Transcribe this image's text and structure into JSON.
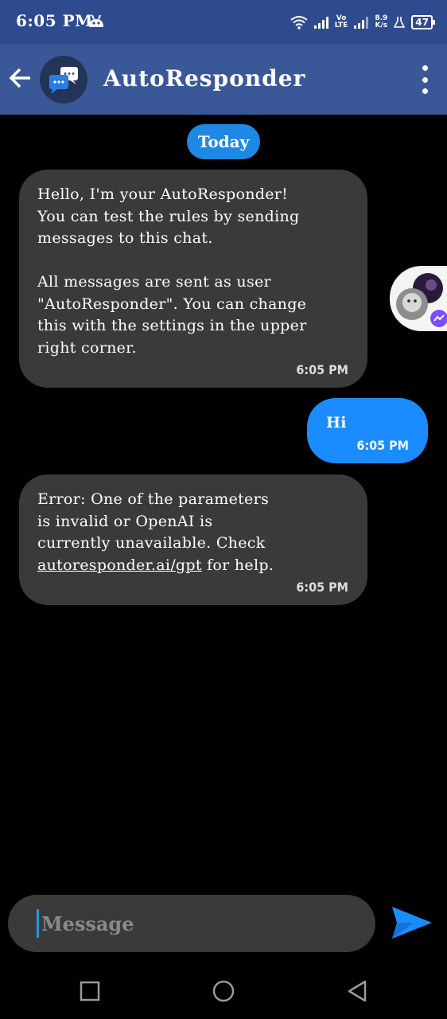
{
  "status": {
    "time": "6:05 PM",
    "vo_lte": [
      "Vo",
      "LTE"
    ],
    "speed": [
      "8.9",
      "K/s"
    ],
    "battery": "47"
  },
  "header": {
    "title": "AutoResponder",
    "back_icon": "arrow-left-icon",
    "menu_icon": "more-vert-icon"
  },
  "chat": {
    "date_label": "Today",
    "messages": [
      {
        "from": "bot",
        "text": "Hello, I'm your AutoResponder!\nYou can test the rules by sending\nmessages to this chat.\n\nAll messages are sent as user\n\"AutoResponder\". You can change\nthis with the settings in the upper\nright corner.",
        "time": "6:05 PM"
      },
      {
        "from": "user",
        "text": "Hi",
        "time": "6:05 PM"
      },
      {
        "from": "bot",
        "text_before": "Error: One of the parameters\nis invalid or OpenAI is\ncurrently unavailable. Check\n",
        "link": "autoresponder.ai/gpt",
        "text_after": " for help.",
        "time": "6:05 PM"
      }
    ]
  },
  "composer": {
    "placeholder": "Message",
    "send_icon": "send-icon"
  },
  "colors": {
    "status_bar": "#2f4b8f",
    "app_bar": "#3a5898",
    "incoming_bubble": "#3a3a3a",
    "outgoing_bubble": "#1a8cff",
    "accent": "#1e88e5"
  }
}
